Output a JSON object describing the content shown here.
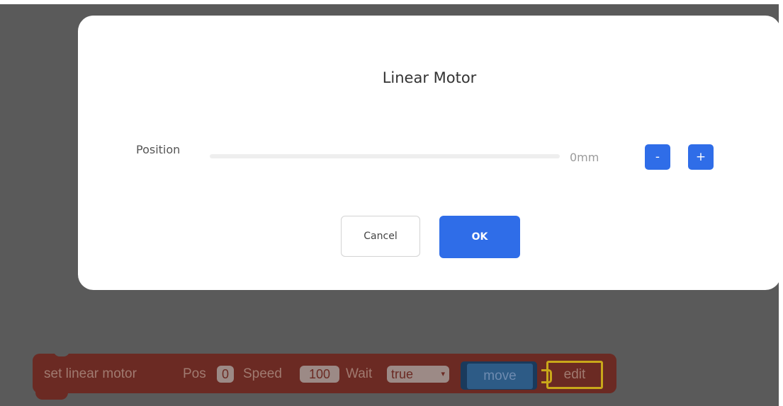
{
  "dialog": {
    "title": "Linear Motor",
    "position_label": "Position",
    "position_value": "0mm",
    "position_level": 0,
    "minus_label": "-",
    "plus_label": "+",
    "cancel_label": "Cancel",
    "ok_label": "OK"
  },
  "block": {
    "label": "set linear motor",
    "pos_label": "Pos",
    "pos_value": "0",
    "speed_label": "Speed",
    "speed_value": "100",
    "wait_label": "Wait",
    "wait_value": "true",
    "move_label": "move",
    "edit_label": "edit"
  },
  "colors": {
    "accent": "#2f6de8",
    "backdrop": "#5a5a5a",
    "block": "#6b2a23",
    "move_block": "#2d5b86",
    "edit_outline": "#c9a81a"
  }
}
